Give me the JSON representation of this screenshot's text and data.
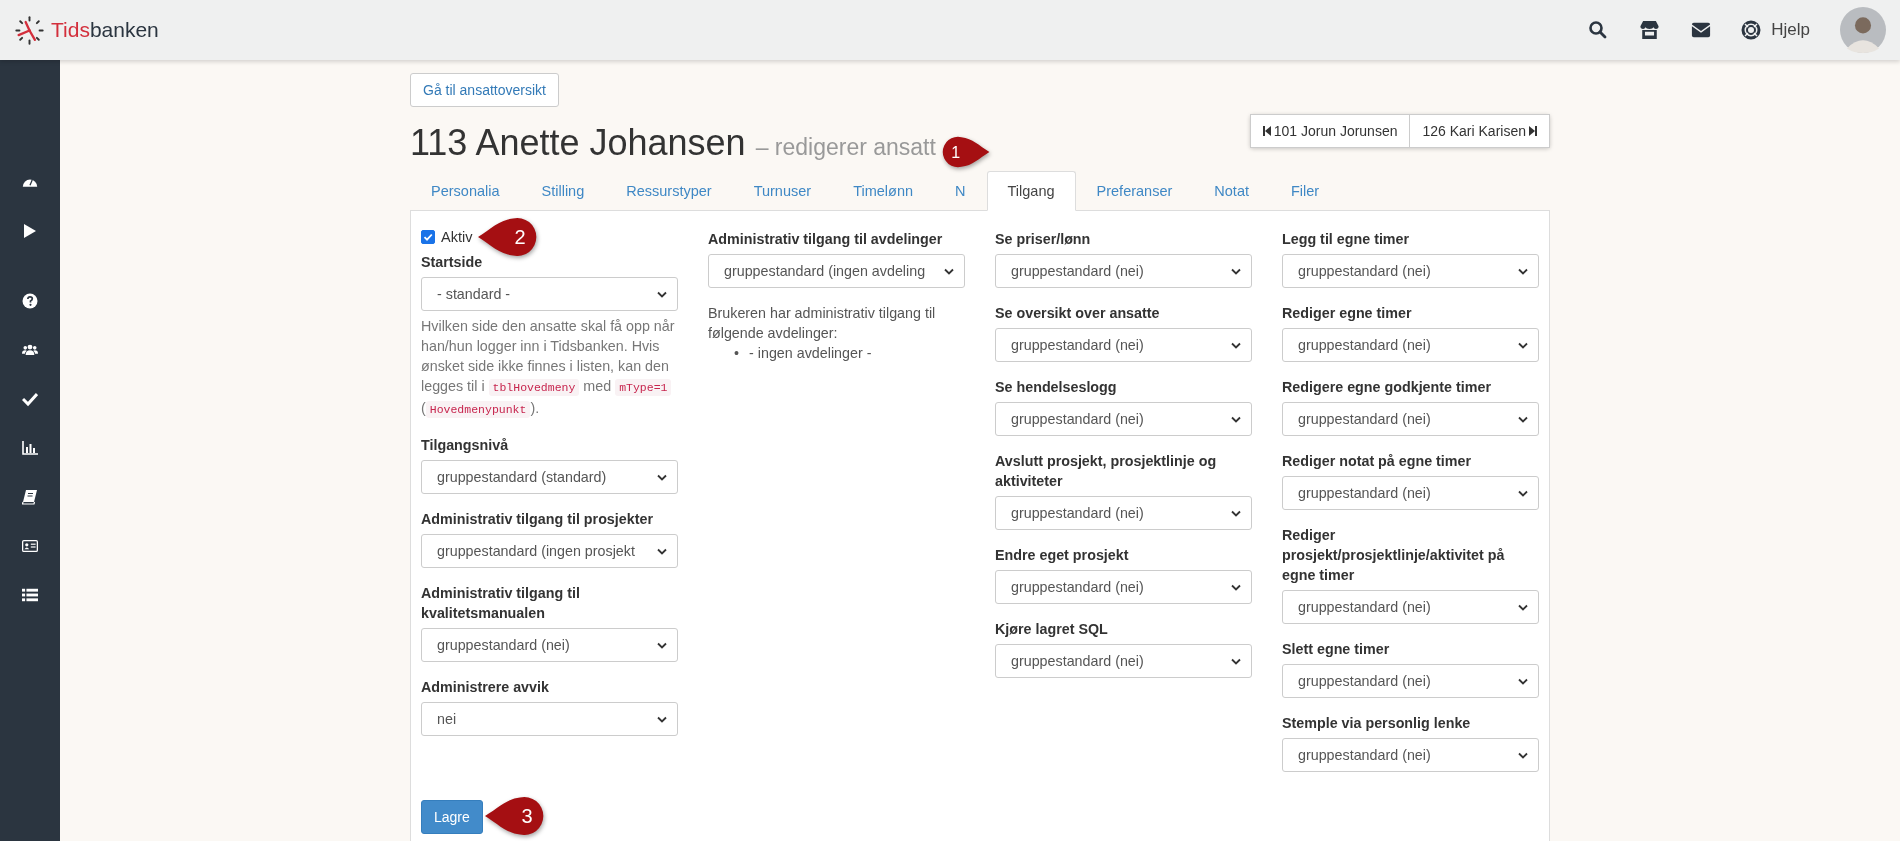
{
  "logo": {
    "accent": "Tids",
    "rest": "banken"
  },
  "topbar": {
    "help": "Hjelp"
  },
  "back_button": "Gå til ansattoversikt",
  "title": {
    "main": "113 Anette Johansen",
    "sub": "– redigerer ansatt"
  },
  "nav": {
    "prev": "101 Jorun Jorunsen",
    "next": "126 Kari Karisen"
  },
  "tabs": [
    {
      "label": "Personalia",
      "selected": false
    },
    {
      "label": "Stilling",
      "selected": false
    },
    {
      "label": "Ressurstyper",
      "selected": false
    },
    {
      "label": "Turnuser",
      "selected": false
    },
    {
      "label": "Timelønn",
      "selected": false
    },
    {
      "label": "N",
      "selected": false
    },
    {
      "label": "Tilgang",
      "selected": true,
      "callout": "1"
    },
    {
      "label": "Preferanser",
      "selected": false
    },
    {
      "label": "Notat",
      "selected": false
    },
    {
      "label": "Filer",
      "selected": false
    }
  ],
  "columns": [
    [
      {
        "kind": "checkbox",
        "label": "Aktiv",
        "checked": true,
        "callout": "2"
      },
      {
        "kind": "select",
        "label": "Startside",
        "value": "- standard -"
      },
      {
        "kind": "help",
        "segments": [
          {
            "kind": "text",
            "text": "Hvilken side den ansatte skal få opp når han/hun logger inn i Tidsbanken. Hvis ønsket side ikke finnes i listen, kan den legges til i "
          },
          {
            "kind": "code",
            "text": "tblHovedmeny"
          },
          {
            "kind": "text",
            "text": " med "
          },
          {
            "kind": "code",
            "text": "mType=1"
          },
          {
            "kind": "text",
            "text": " ("
          },
          {
            "kind": "code",
            "text": "Hovedmenypunkt"
          },
          {
            "kind": "text",
            "text": ")."
          }
        ]
      },
      {
        "kind": "select",
        "label": "Tilgangsnivå",
        "value": "gruppestandard (standard)"
      },
      {
        "kind": "select",
        "label": "Administrativ tilgang til prosjekter",
        "value": "gruppestandard (ingen prosjekt"
      },
      {
        "kind": "select",
        "label": "Administrativ tilgang til kvalitetsmanualen",
        "value": "gruppestandard (nei)"
      },
      {
        "kind": "select",
        "label": "Administrere avvik",
        "value": "nei"
      }
    ],
    [
      {
        "kind": "select",
        "label": "Administrativ tilgang til avdelinger",
        "value": "gruppestandard (ingen avdeling"
      },
      {
        "kind": "info",
        "text": "Brukeren har administrativ tilgang til følgende avdelinger:",
        "items": [
          {
            "bullet": "•",
            "text": "- ingen avdelinger -"
          }
        ]
      }
    ],
    [
      {
        "kind": "select",
        "label": "Se priser/lønn",
        "value": "gruppestandard (nei)"
      },
      {
        "kind": "select",
        "label": "Se oversikt over ansatte",
        "value": "gruppestandard (nei)"
      },
      {
        "kind": "select",
        "label": "Se hendelseslogg",
        "value": "gruppestandard (nei)"
      },
      {
        "kind": "select",
        "label": "Avslutt prosjekt, prosjektlinje og aktiviteter",
        "value": "gruppestandard (nei)"
      },
      {
        "kind": "select",
        "label": "Endre eget prosjekt",
        "value": "gruppestandard (nei)"
      },
      {
        "kind": "select",
        "label": "Kjøre lagret SQL",
        "value": "gruppestandard (nei)"
      }
    ],
    [
      {
        "kind": "select",
        "label": "Legg til egne timer",
        "value": "gruppestandard (nei)"
      },
      {
        "kind": "select",
        "label": "Rediger egne timer",
        "value": "gruppestandard (nei)"
      },
      {
        "kind": "select",
        "label": "Redigere egne godkjente timer",
        "value": "gruppestandard (nei)"
      },
      {
        "kind": "select",
        "label": "Rediger notat på egne timer",
        "value": "gruppestandard (nei)"
      },
      {
        "kind": "select",
        "label": "Rediger prosjekt/prosjektlinje/aktivitet på egne timer",
        "value": "gruppestandard (nei)"
      },
      {
        "kind": "select",
        "label": "Slett egne timer",
        "value": "gruppestandard (nei)"
      },
      {
        "kind": "select",
        "label": "Stemple via personlig lenke",
        "value": "gruppestandard (nei)"
      }
    ]
  ],
  "save": {
    "label": "Lagre",
    "callout": "3"
  }
}
